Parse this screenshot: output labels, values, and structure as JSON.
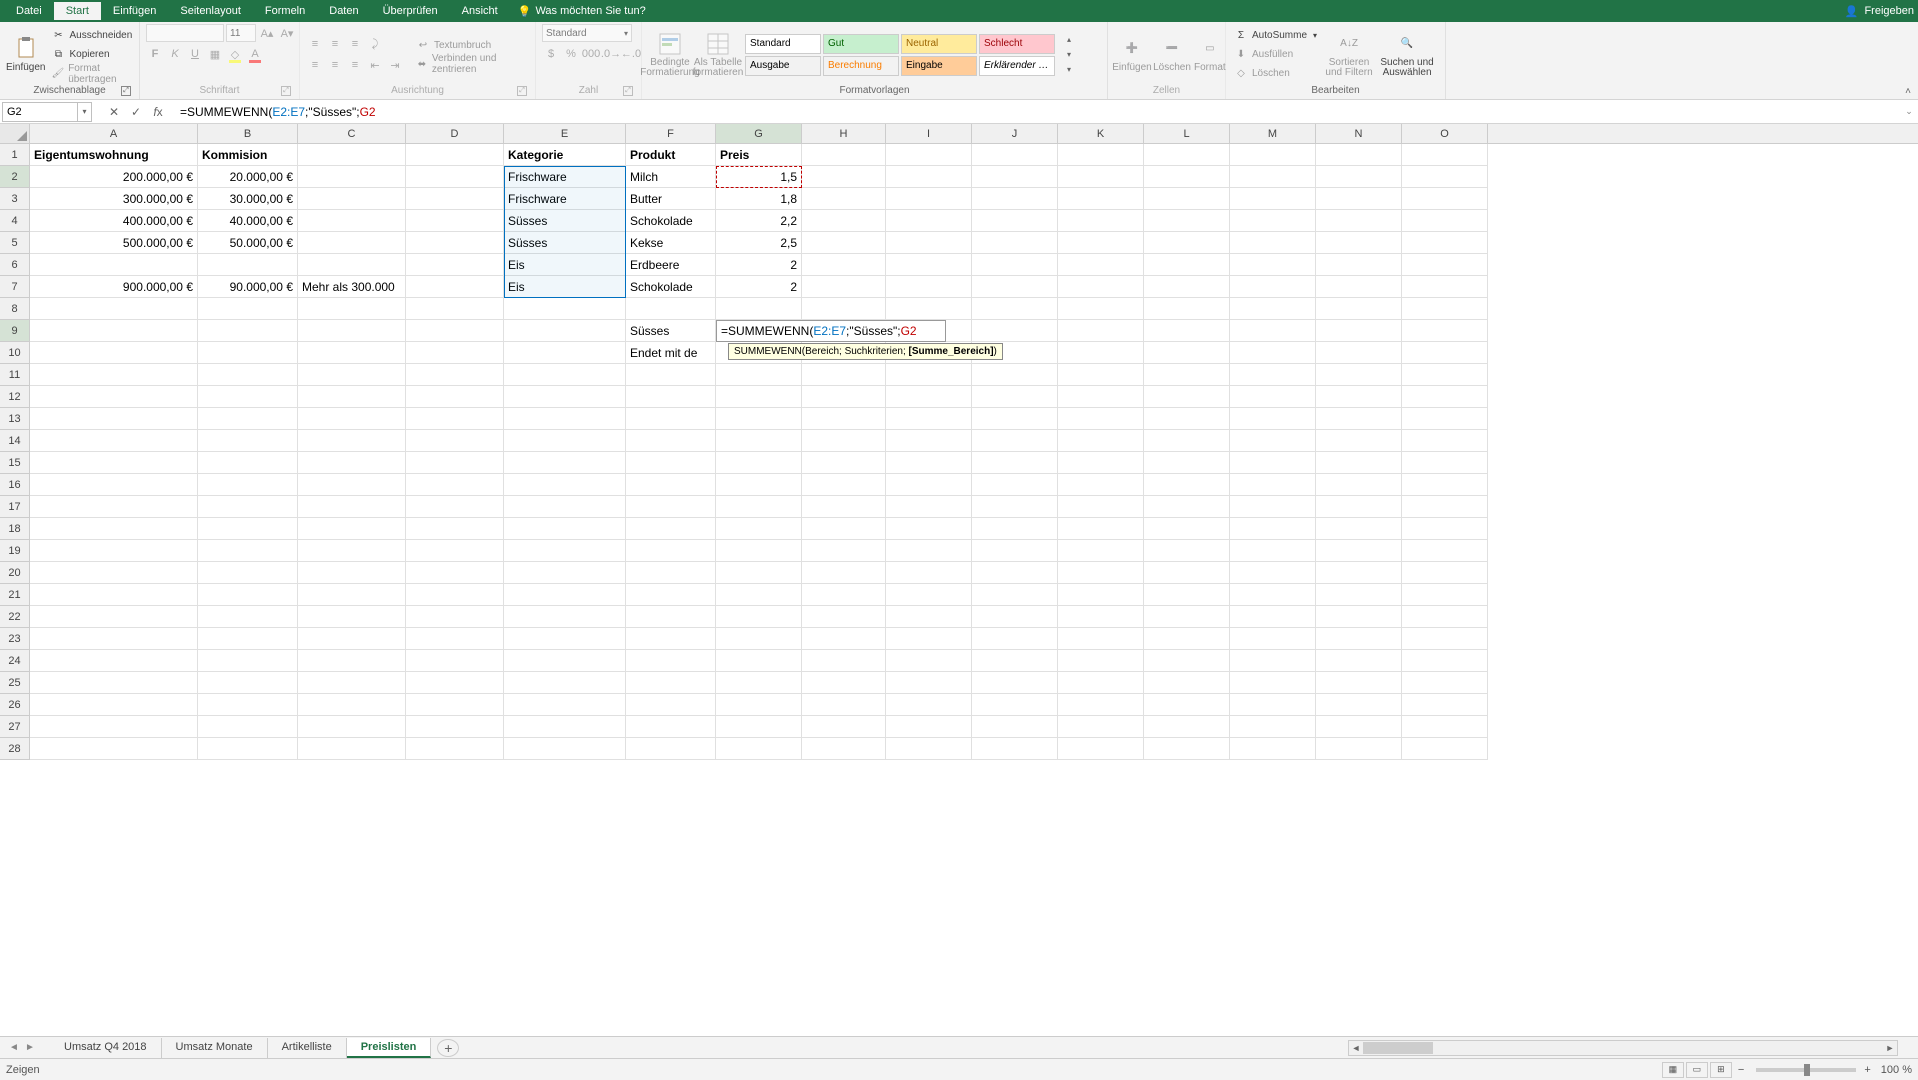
{
  "titlebar": {
    "tabs": [
      "Datei",
      "Start",
      "Einfügen",
      "Seitenlayout",
      "Formeln",
      "Daten",
      "Überprüfen",
      "Ansicht"
    ],
    "active_tab": 1,
    "tellme": "Was möchten Sie tun?",
    "share": "Freigeben"
  },
  "ribbon": {
    "clipboard": {
      "paste": "Einfügen",
      "cut": "Ausschneiden",
      "copy": "Kopieren",
      "painter": "Format übertragen",
      "label": "Zwischenablage"
    },
    "font": {
      "size": "11",
      "label": "Schriftart"
    },
    "align": {
      "wrap": "Textumbruch",
      "merge": "Verbinden und zentrieren",
      "label": "Ausrichtung"
    },
    "number": {
      "format": "Standard",
      "label": "Zahl"
    },
    "styles": {
      "cond": "Bedingte Formatierung",
      "table": "Als Tabelle formatieren",
      "cells": [
        "Standard",
        "Gut",
        "Neutral",
        "Schlecht",
        "Ausgabe",
        "Berechnung",
        "Eingabe",
        "Erklärender …"
      ],
      "label": "Formatvorlagen"
    },
    "cells": {
      "insert": "Einfügen",
      "delete": "Löschen",
      "format": "Format",
      "label": "Zellen"
    },
    "edit": {
      "sum": "AutoSumme",
      "fill": "Ausfüllen",
      "clear": "Löschen",
      "sort": "Sortieren und Filtern",
      "find": "Suchen und Auswählen",
      "label": "Bearbeiten"
    }
  },
  "namebox": "G2",
  "formula": {
    "prefix": "=SUMMEWENN(",
    "ref1": "E2:E7",
    "mid": ";\"Süsses\";",
    "ref2": "G2",
    "suffix": ""
  },
  "tooltip": {
    "fn": "SUMMEWENN(",
    "arg1": "Bereich",
    "arg2": "Suchkriterien",
    "arg3": "[Summe_Bereich]",
    "close": ")"
  },
  "columns": [
    "A",
    "B",
    "C",
    "D",
    "E",
    "F",
    "G",
    "H",
    "I",
    "J",
    "K",
    "L",
    "M",
    "N",
    "O"
  ],
  "grid": {
    "r1": {
      "A": "Eigentumswohnung",
      "B": "Kommision",
      "E": "Kategorie",
      "F": "Produkt",
      "G": "Preis"
    },
    "r2": {
      "A": "200.000,00 €",
      "B": "20.000,00 €",
      "E": "Frischware",
      "F": "Milch",
      "G": "1,5"
    },
    "r3": {
      "A": "300.000,00 €",
      "B": "30.000,00 €",
      "E": "Frischware",
      "F": "Butter",
      "G": "1,8"
    },
    "r4": {
      "A": "400.000,00 €",
      "B": "40.000,00 €",
      "E": "Süsses",
      "F": "Schokolade",
      "G": "2,2"
    },
    "r5": {
      "A": "500.000,00 €",
      "B": "50.000,00 €",
      "E": "Süsses",
      "F": "Kekse",
      "G": "2,5"
    },
    "r6": {
      "E": "Eis",
      "F": "Erdbeere",
      "G": "2"
    },
    "r7": {
      "A": "900.000,00 €",
      "B": "90.000,00 €",
      "C": "Mehr als 300.000",
      "E": "Eis",
      "F": "Schokolade",
      "G": "2"
    },
    "r9": {
      "F": "Süsses"
    },
    "r10": {
      "F": "Endet mit de"
    }
  },
  "sheets": {
    "list": [
      "Umsatz Q4 2018",
      "Umsatz Monate",
      "Artikelliste",
      "Preislisten"
    ],
    "active": 3
  },
  "status": "Zeigen",
  "zoom": "100 %",
  "chart_data": null
}
